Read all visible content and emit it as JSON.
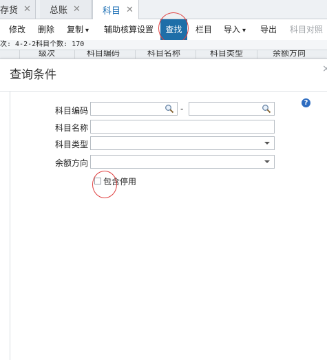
{
  "tabs": [
    {
      "label": "存货",
      "close": "✕"
    },
    {
      "label": "总账",
      "close": "✕"
    },
    {
      "label": "科目",
      "close": "✕"
    }
  ],
  "toolbar": {
    "items": [
      {
        "label": "修改"
      },
      {
        "label": "删除"
      },
      {
        "label": "复制",
        "caret": "▾"
      },
      {
        "label": "辅助核算设置"
      },
      {
        "label": "查找"
      },
      {
        "label": "栏目"
      },
      {
        "label": "导入",
        "caret": "▾"
      },
      {
        "label": "导出"
      },
      {
        "label": "科目对照"
      }
    ]
  },
  "info": {
    "text": "次: 4-2-2科目个数: 170"
  },
  "grid": {
    "columns": [
      "级次",
      "科目编码",
      "科目名称",
      "科目类型",
      "余额方向"
    ]
  },
  "dialog": {
    "title": "查询条件",
    "close": "×",
    "help": "?",
    "fields": {
      "code_label": "科目编码",
      "code_from": "",
      "code_to": "",
      "range_sep": "-",
      "name_label": "科目名称",
      "name_value": "",
      "type_label": "科目类型",
      "type_value": "",
      "balance_label": "余额方向",
      "balance_value": ""
    },
    "include_disabled": {
      "label": "包含停用",
      "checked": false
    }
  },
  "colors": {
    "accent": "#1e6ea8",
    "annotation": "#e04040"
  }
}
